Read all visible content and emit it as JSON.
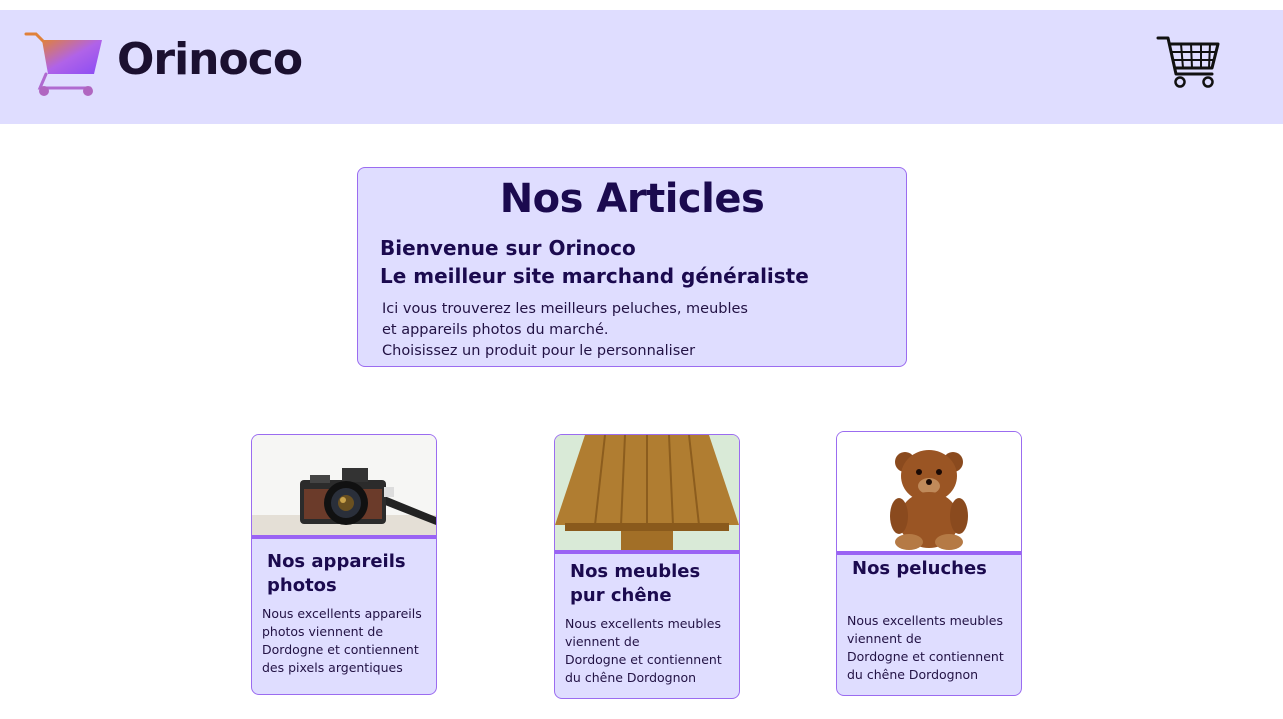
{
  "header": {
    "brand": "Orinoco",
    "logo_icon": "shopping-cart-gradient-icon",
    "cart_icon": "shopping-cart-icon"
  },
  "intro": {
    "title": "Nos Articles",
    "subtitle_line1": "Bienvenue sur Orinoco",
    "subtitle_line2": "Le meilleur site marchand généraliste",
    "text_line1": "Ici vous trouverez les meilleurs peluches, meubles",
    "text_line2": "et appareils photos du marché.",
    "text_line3": "Choisissez un produit pour le personnaliser"
  },
  "products": [
    {
      "title_line1": "Nos appareils",
      "title_line2": "photos",
      "desc_line1": "Nous excellents appareils",
      "desc_line2": " photos viennent de",
      "desc_line3": "Dordogne et contiennent",
      "desc_line4": " des pixels argentiques",
      "image": "camera-photo"
    },
    {
      "title_line1": "Nos meubles",
      "title_line2": "pur chêne",
      "desc_line1": "Nous excellents meubles",
      "desc_line2": " viennent de",
      "desc_line3": "Dordogne et contiennent",
      "desc_line4": " du chêne Dordognon",
      "image": "oak-table-photo"
    },
    {
      "title_line1": "Nos peluches",
      "title_line2": "",
      "desc_line1": "Nous excellents meubles",
      "desc_line2": " viennent de",
      "desc_line3": "Dordogne et contiennent",
      "desc_line4": " du chêne Dordognon",
      "image": "teddy-bear-photo"
    }
  ],
  "colors": {
    "panel_bg": "#dfddff",
    "accent": "#9a63f4",
    "text_dark": "#1b0a4f"
  }
}
